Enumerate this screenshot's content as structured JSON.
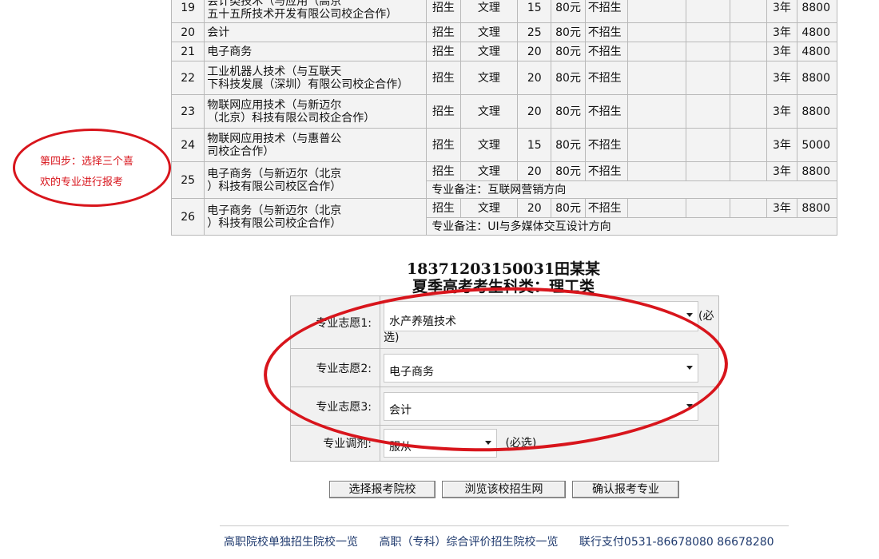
{
  "table": {
    "rows": [
      {
        "no": "19",
        "name_lines": [
          "会计类技术（与应用（高京",
          "五十五所技术开发有限公司校企合作）"
        ],
        "recruit": "招生",
        "subject": "文理",
        "plan": "15",
        "fee": "80元",
        "status": "不招生",
        "years": "3年",
        "tuition": "8800"
      },
      {
        "no": "20",
        "name_lines": [
          "会计"
        ],
        "recruit": "招生",
        "subject": "文理",
        "plan": "25",
        "fee": "80元",
        "status": "不招生",
        "years": "3年",
        "tuition": "4800"
      },
      {
        "no": "21",
        "name_lines": [
          "电子商务"
        ],
        "recruit": "招生",
        "subject": "文理",
        "plan": "20",
        "fee": "80元",
        "status": "不招生",
        "years": "3年",
        "tuition": "4800"
      },
      {
        "no": "22",
        "name_lines": [
          "工业机器人技术（与互联天",
          "下科技发展（深圳）有限公司校企合作）"
        ],
        "recruit": "招生",
        "subject": "文理",
        "plan": "20",
        "fee": "80元",
        "status": "不招生",
        "years": "3年",
        "tuition": "8800"
      },
      {
        "no": "23",
        "name_lines": [
          "物联网应用技术（与新迈尔",
          "（北京）科技有限公司校企合作）"
        ],
        "recruit": "招生",
        "subject": "文理",
        "plan": "20",
        "fee": "80元",
        "status": "不招生",
        "years": "3年",
        "tuition": "8800"
      },
      {
        "no": "24",
        "name_lines": [
          "物联网应用技术（与惠普公",
          "司校企合作）"
        ],
        "recruit": "招生",
        "subject": "文理",
        "plan": "15",
        "fee": "80元",
        "status": "不招生",
        "years": "3年",
        "tuition": "5000"
      },
      {
        "no": "25",
        "name_lines": [
          "电子商务（与新迈尔（北京",
          "）科技有限公司校区合作）"
        ],
        "recruit": "招生",
        "subject": "文理",
        "plan": "20",
        "fee": "80元",
        "status": "不招生",
        "years": "3年",
        "tuition": "8800",
        "note": "专业备注：互联网营销方向"
      },
      {
        "no": "26",
        "name_lines": [
          "电子商务（与新迈尔（北京",
          "）科技有限公司校企合作）"
        ],
        "recruit": "招生",
        "subject": "文理",
        "plan": "20",
        "fee": "80元",
        "status": "不招生",
        "years": "3年",
        "tuition": "8800",
        "note": "专业备注：UI与多媒体交互设计方向"
      }
    ]
  },
  "annotation": {
    "line1": "第四步：选择三个喜",
    "line2": "欢的专业进行报考"
  },
  "student": {
    "id_name": "18371203150031田某某",
    "category": "夏季高考考生科类：理工类"
  },
  "form": {
    "choice1": {
      "label": "专业志愿1:",
      "value": "水产养殖技术",
      "required": "(必",
      "required2": "选)"
    },
    "choice2": {
      "label": "专业志愿2:",
      "value": "电子商务"
    },
    "choice3": {
      "label": "专业志愿3:",
      "value": "会计"
    },
    "adjust": {
      "label": "专业调剂:",
      "value": "服从",
      "required": "(必选)"
    }
  },
  "buttons": {
    "select_school": "选择报考院校",
    "browse_site": "浏览该校招生网",
    "confirm": "确认报考专业"
  },
  "footer": {
    "link1": "高职院校单独招生院校一览",
    "link2": "高职（专科）综合评价招生院校一览",
    "contact": "联行支付0531-86678080  86678280"
  },
  "colors": {
    "annotation": "#d8151c",
    "footer_link": "#1f3a6e"
  }
}
